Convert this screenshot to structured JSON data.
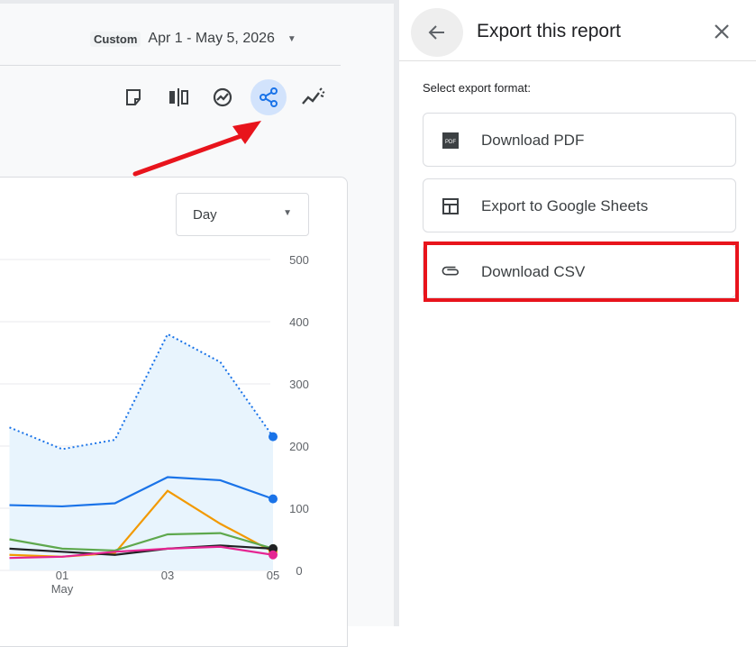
{
  "header": {
    "date_range_mode": "Custom",
    "date_range": "Apr 1 - May 5, 2026"
  },
  "toolbar": {
    "icons": [
      "note-icon",
      "compare-icon",
      "insights-icon",
      "share-icon",
      "anomaly-icon"
    ],
    "active": "share-icon"
  },
  "granularity_select": {
    "value": "Day"
  },
  "chart_data": {
    "type": "line",
    "x": [
      "",
      "01",
      "",
      "03",
      "",
      "05"
    ],
    "x_sublabel": "May",
    "y_ticks": [
      0,
      100,
      200,
      300,
      400,
      500
    ],
    "ylim": [
      0,
      500
    ],
    "grid": true,
    "series": [
      {
        "style": "dotted-area",
        "color": "#1a73e8",
        "values": [
          230,
          195,
          210,
          380,
          335,
          215
        ]
      },
      {
        "style": "solid",
        "color": "#1a73e8",
        "values": [
          105,
          103,
          108,
          150,
          145,
          115
        ]
      },
      {
        "style": "solid",
        "color": "#f29900",
        "values": [
          25,
          22,
          28,
          128,
          75,
          30
        ]
      },
      {
        "style": "solid",
        "color": "#5ea84d",
        "values": [
          50,
          35,
          32,
          58,
          60,
          35
        ]
      },
      {
        "style": "solid",
        "color": "#202124",
        "values": [
          35,
          30,
          25,
          35,
          40,
          35
        ]
      },
      {
        "style": "solid",
        "color": "#e52592",
        "values": [
          20,
          22,
          30,
          35,
          38,
          25
        ]
      }
    ]
  },
  "panel": {
    "title": "Export this report",
    "format_label": "Select export format:",
    "options": [
      {
        "label": "Download PDF",
        "icon": "pdf-icon"
      },
      {
        "label": "Export to Google Sheets",
        "icon": "sheets-grid-icon"
      },
      {
        "label": "Download CSV",
        "icon": "paperclip-icon"
      }
    ]
  },
  "colors": {
    "accent": "#1a73e8",
    "highlight": "#e8141c",
    "active_bg": "#d2e3fc"
  }
}
